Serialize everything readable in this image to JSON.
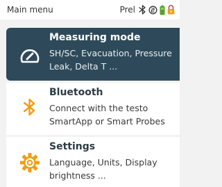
{
  "status_bar": {
    "title": "Main menu",
    "mode": "Prel",
    "icons": [
      "bluetooth-icon",
      "record-icon",
      "battery-icon",
      "lock-icon"
    ]
  },
  "colors": {
    "selected_bg": "#2e4a5a",
    "bluetooth": "#f39c12",
    "battery": "#5aa02c",
    "lock": "#e67e22",
    "settings": "#f39c12"
  },
  "menu": {
    "items": [
      {
        "title": "Measuring mode",
        "description": "SH/SC, Evacuation, Pressure Leak, Delta T ...",
        "icon": "gauge-icon",
        "selected": true
      },
      {
        "title": "Bluetooth",
        "description": "Connect with the testo SmartApp or Smart Probes",
        "icon": "bluetooth-icon",
        "selected": false
      },
      {
        "title": "Settings",
        "description": "Language, Units, Display brightness ...",
        "icon": "gear-icon",
        "selected": false
      }
    ]
  }
}
